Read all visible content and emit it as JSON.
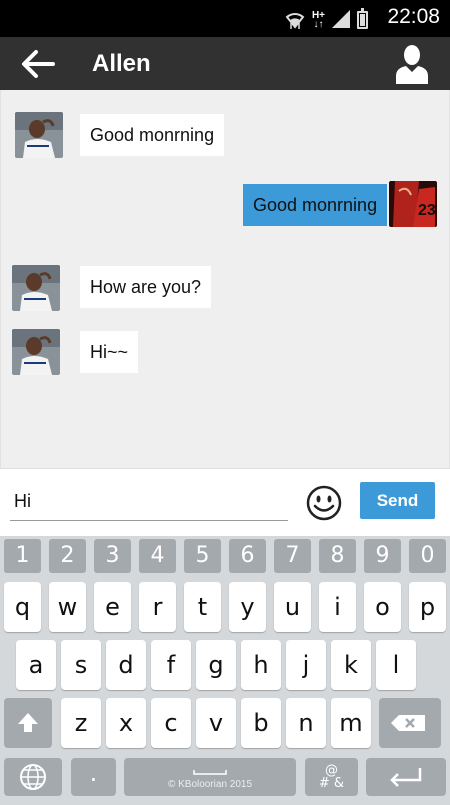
{
  "status_bar": {
    "time": "22:08",
    "network": "H+"
  },
  "header": {
    "title": "Allen"
  },
  "messages": [
    {
      "direction": "in",
      "text": "Good monrning"
    },
    {
      "direction": "out",
      "text": "Good monrning"
    },
    {
      "direction": "in",
      "text": "How are you?"
    },
    {
      "direction": "in",
      "text": "Hi~~"
    }
  ],
  "composer": {
    "input_value": "Hi",
    "send_label": "Send"
  },
  "keyboard": {
    "number_row": [
      "1",
      "2",
      "3",
      "4",
      "5",
      "6",
      "7",
      "8",
      "9",
      "0"
    ],
    "row1": [
      "q",
      "w",
      "e",
      "r",
      "t",
      "y",
      "u",
      "i",
      "o",
      "p"
    ],
    "row2": [
      "a",
      "s",
      "d",
      "f",
      "g",
      "h",
      "j",
      "k",
      "l"
    ],
    "row3": [
      "z",
      "x",
      "c",
      "v",
      "b",
      "n",
      "m"
    ],
    "period": ".",
    "space_branding": "© KBoloorian 2015",
    "symbols_top": "@",
    "symbols_bottom": "# &"
  },
  "colors": {
    "accent": "#3c9ad9",
    "app_bar": "#313131",
    "chat_bg": "#efefef"
  }
}
